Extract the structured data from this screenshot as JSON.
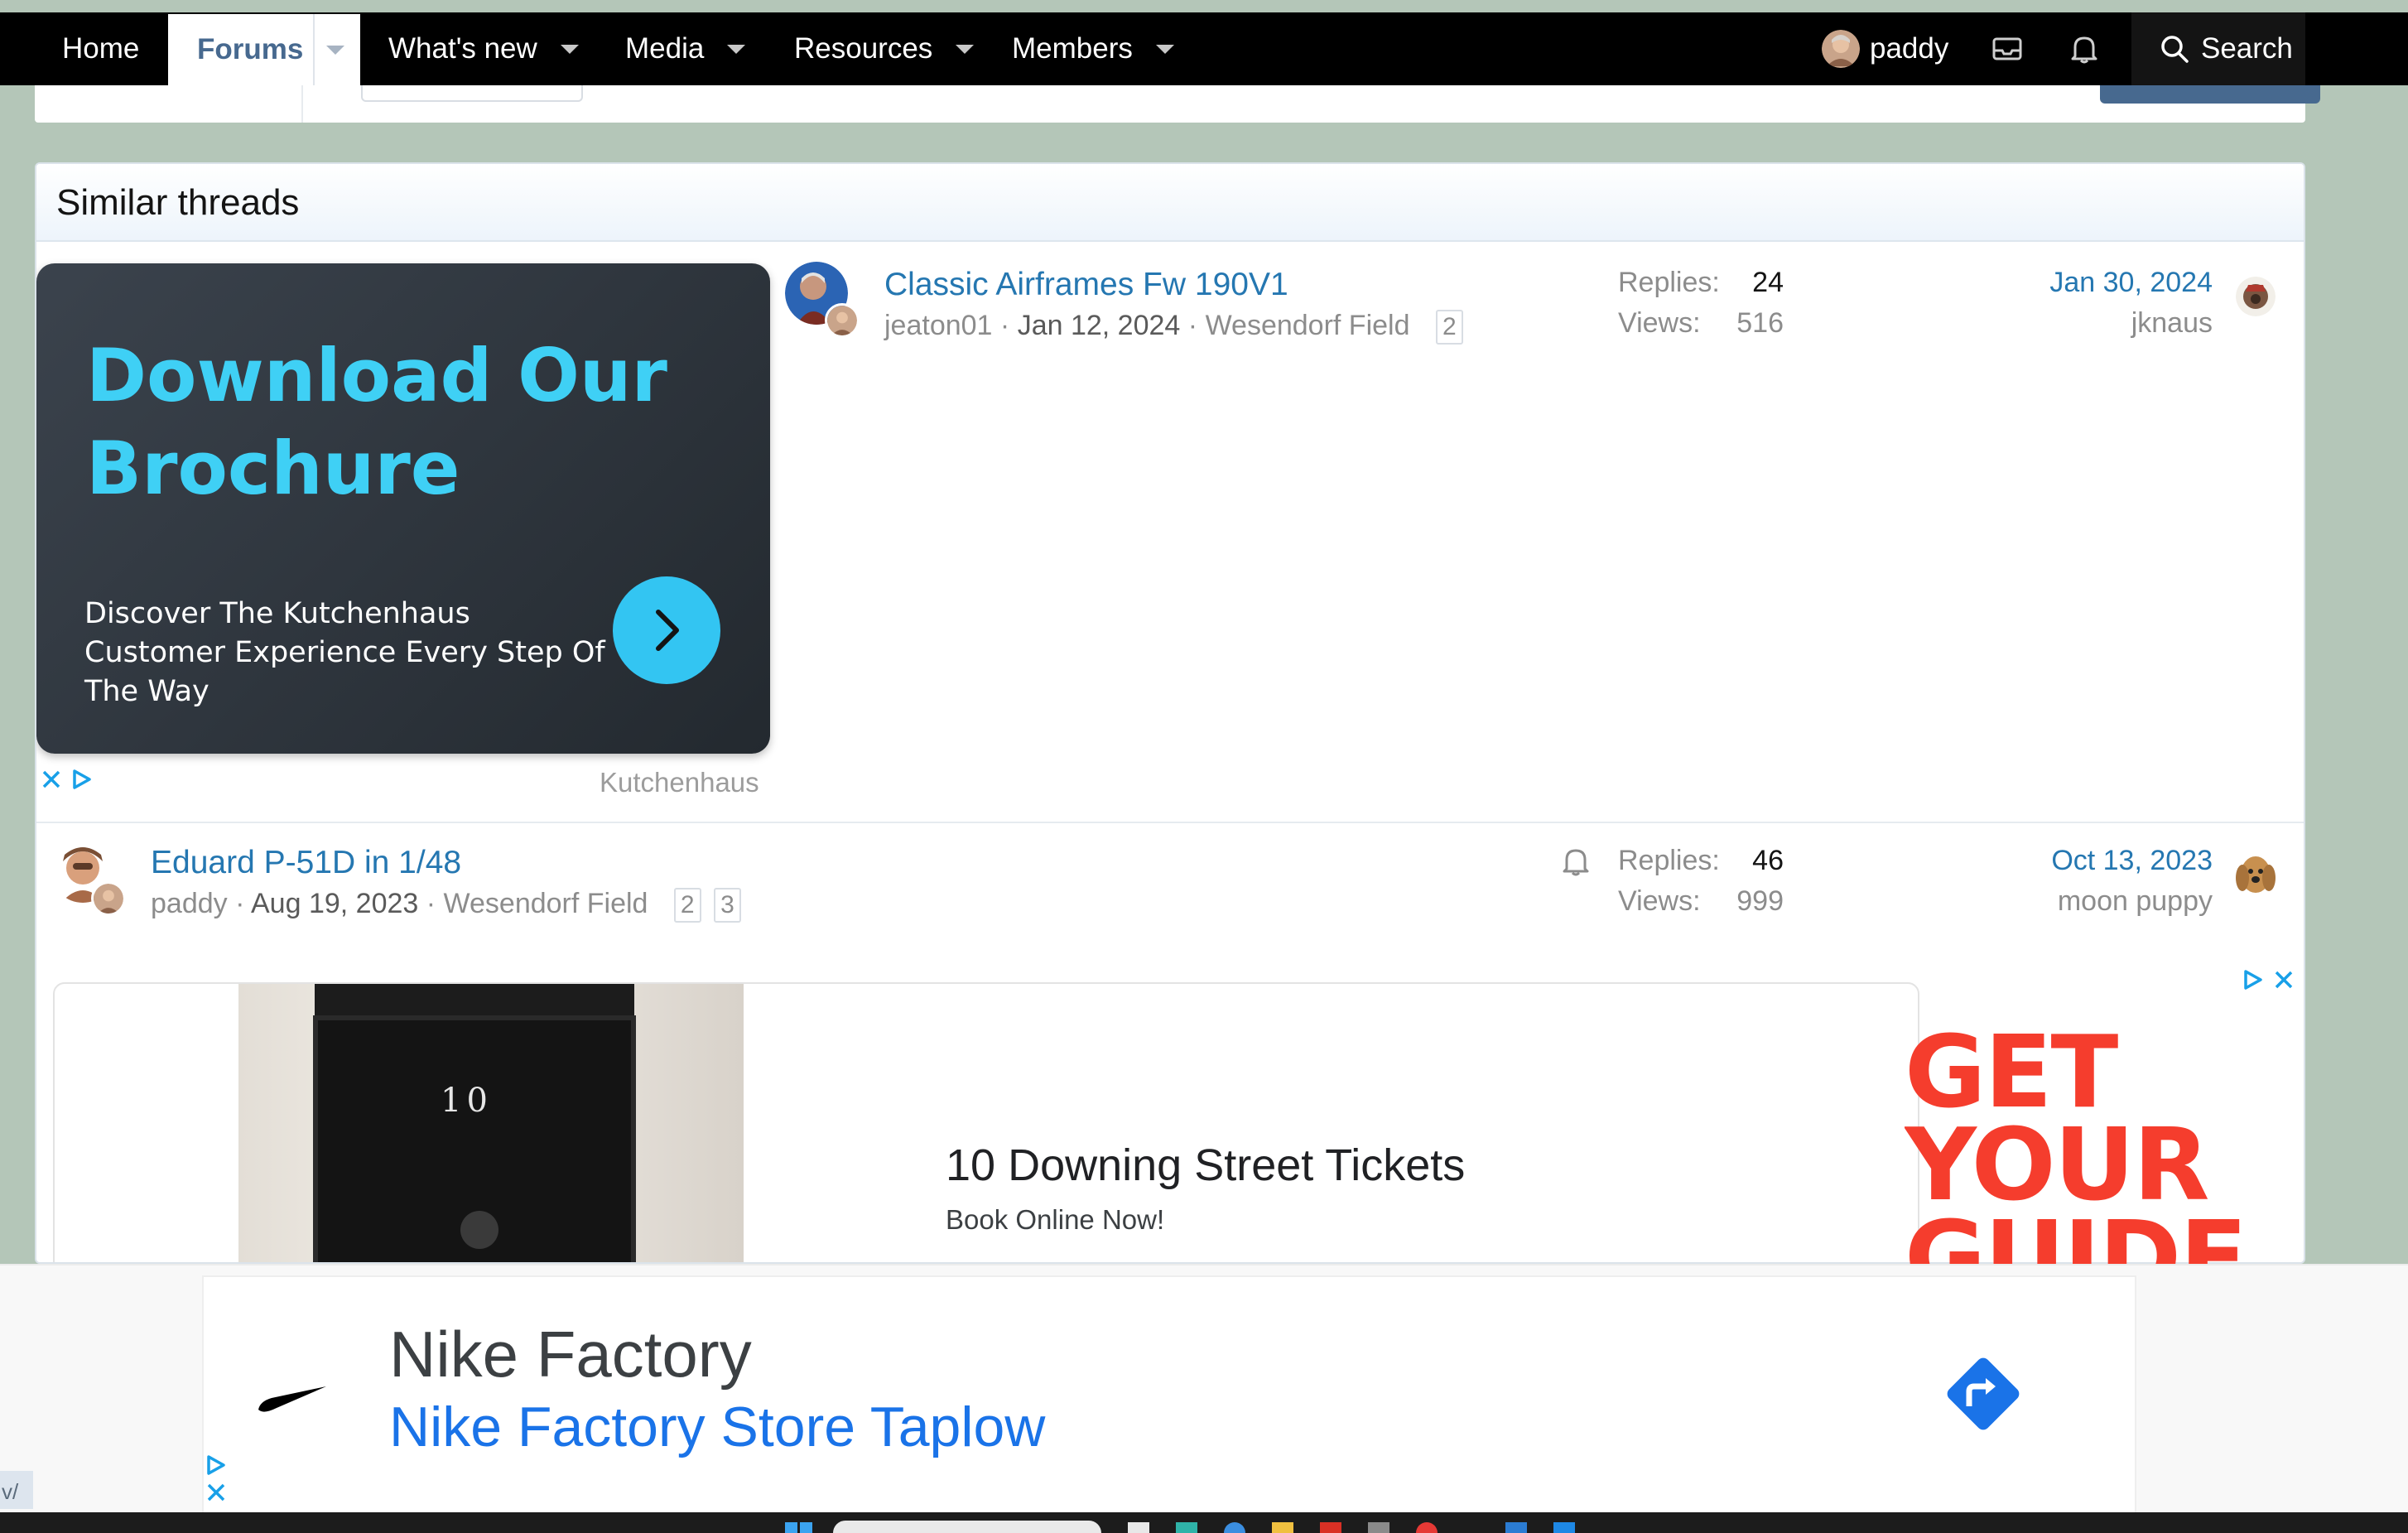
{
  "nav": {
    "items": [
      {
        "label": "Home"
      },
      {
        "label": "Forums",
        "active": true
      },
      {
        "label": "What's new"
      },
      {
        "label": "Media"
      },
      {
        "label": "Resources"
      },
      {
        "label": "Members"
      }
    ],
    "user": {
      "name": "paddy"
    },
    "search_label": "Search"
  },
  "similar_threads": {
    "title": "Similar threads",
    "threads": [
      {
        "title": "Classic Airframes Fw 190V1",
        "author": "jeaton01",
        "date": "Jan 12, 2024",
        "forum": "Wesendorf Field",
        "pages": [
          "2"
        ],
        "replies_label": "Replies:",
        "replies": "24",
        "views_label": "Views:",
        "views": "516",
        "last_date": "Jan 30, 2024",
        "last_user": "jknaus"
      },
      {
        "title": "Eduard P-51D in 1/48",
        "author": "paddy",
        "date": "Aug 19, 2023",
        "forum": "Wesendorf Field",
        "pages": [
          "2",
          "3"
        ],
        "replies_label": "Replies:",
        "replies": "46",
        "views_label": "Views:",
        "views": "999",
        "last_date": "Oct 13, 2023",
        "last_user": "moon puppy"
      }
    ]
  },
  "ads": {
    "brochure": {
      "headline": "Download Our Brochure",
      "body": "Discover The Kutchenhaus Customer Experience Every Step Of The Way",
      "sponsor": "Kutchenhaus",
      "accent": "#3fd0f5"
    },
    "downing": {
      "door_number": "10",
      "title": "10 Downing Street Tickets",
      "subtitle": "Book Online Now!"
    },
    "getyourguide": {
      "text": "GET YOUR GUIDE",
      "color": "#f53d2d"
    },
    "nike": {
      "title": "Nike Factory",
      "subtitle": "Nike Factory Store Taplow",
      "link_color": "#1a73e8"
    }
  },
  "browser": {
    "url_fragment": "v/"
  },
  "colors": {
    "nav_bg": "#000000",
    "link": "#2577b1",
    "page_bg": "#b4c6b8",
    "forum_blue": "#47698f"
  }
}
